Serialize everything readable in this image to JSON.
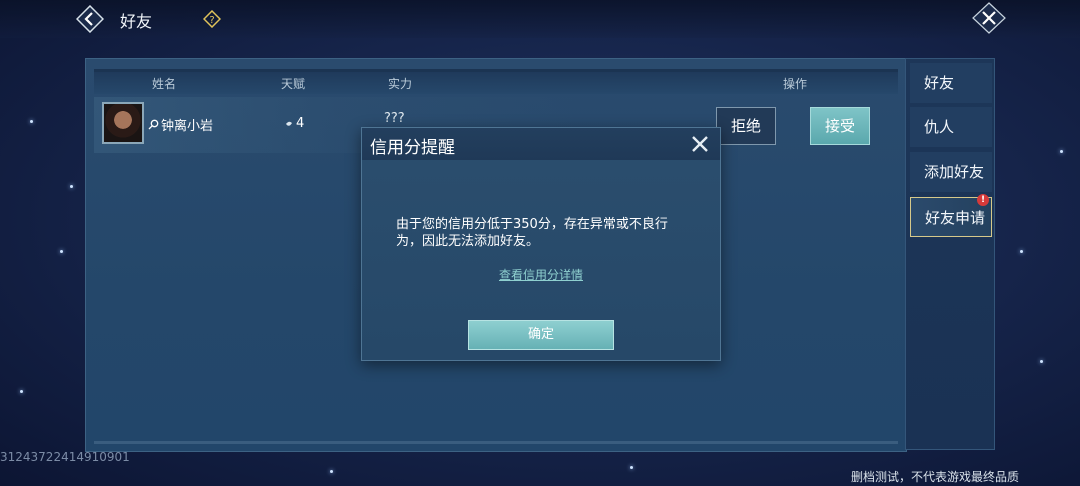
{
  "topbar": {
    "title": "好友",
    "back_icon": "back-arrow-icon",
    "help_icon": "question-icon",
    "close_icon": "close-icon"
  },
  "table": {
    "headers": [
      "姓名",
      "天赋",
      "实力",
      "操作"
    ],
    "rows": [
      {
        "name": "钟离小岩",
        "talent": "4",
        "power": "???",
        "reject_label": "拒绝",
        "accept_label": "接受"
      }
    ]
  },
  "sidebar": {
    "tabs": [
      {
        "label": "好友",
        "active": false
      },
      {
        "label": "仇人",
        "active": false
      },
      {
        "label": "添加好友",
        "active": false
      },
      {
        "label": "好友申请",
        "active": true,
        "badge": "!"
      }
    ]
  },
  "modal": {
    "title": "信用分提醒",
    "message": "由于您的信用分低于350分，存在异常或不良行为，因此无法添加好友。",
    "link": "查看信用分详情",
    "confirm_label": "确定"
  },
  "footer": {
    "uid": "31243722414910901",
    "disclaimer": "删档测试，不代表游戏最终品质"
  },
  "colors": {
    "accent": "#6fbcbf",
    "badge": "#d63a3a",
    "active_tab_border": "#d6c98a"
  }
}
